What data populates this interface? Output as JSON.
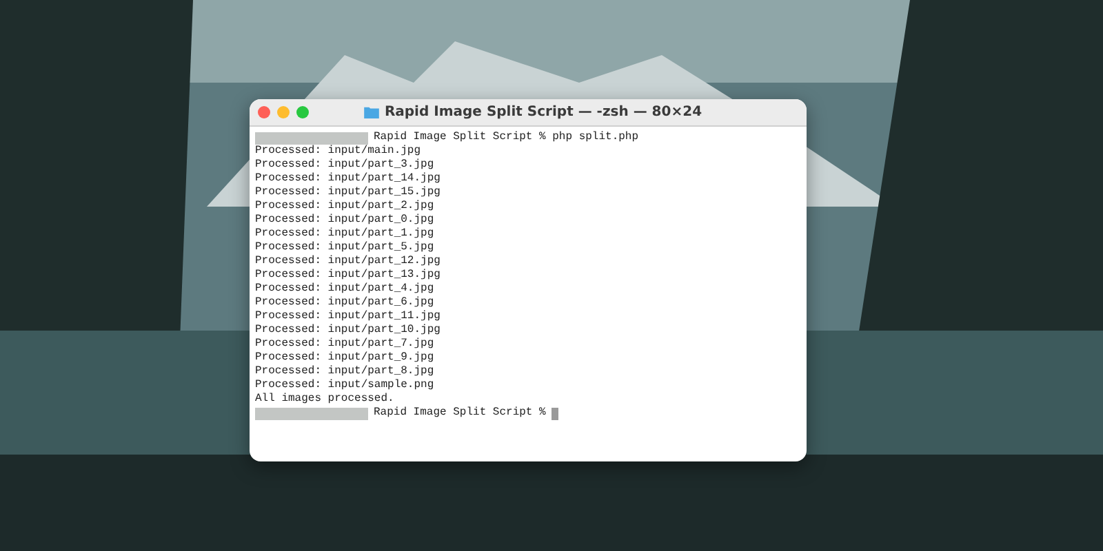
{
  "window": {
    "title": "Rapid Image Split Script — -zsh — 80×24"
  },
  "terminal": {
    "lines": [
      {
        "kind": "prompt",
        "text": "Rapid Image Split Script % php split.php",
        "cursor": false
      },
      {
        "kind": "output",
        "text": "Processed: input/main.jpg"
      },
      {
        "kind": "output",
        "text": "Processed: input/part_3.jpg"
      },
      {
        "kind": "output",
        "text": "Processed: input/part_14.jpg"
      },
      {
        "kind": "output",
        "text": "Processed: input/part_15.jpg"
      },
      {
        "kind": "output",
        "text": "Processed: input/part_2.jpg"
      },
      {
        "kind": "output",
        "text": "Processed: input/part_0.jpg"
      },
      {
        "kind": "output",
        "text": "Processed: input/part_1.jpg"
      },
      {
        "kind": "output",
        "text": "Processed: input/part_5.jpg"
      },
      {
        "kind": "output",
        "text": "Processed: input/part_12.jpg"
      },
      {
        "kind": "output",
        "text": "Processed: input/part_13.jpg"
      },
      {
        "kind": "output",
        "text": "Processed: input/part_4.jpg"
      },
      {
        "kind": "output",
        "text": "Processed: input/part_6.jpg"
      },
      {
        "kind": "output",
        "text": "Processed: input/part_11.jpg"
      },
      {
        "kind": "output",
        "text": "Processed: input/part_10.jpg"
      },
      {
        "kind": "output",
        "text": "Processed: input/part_7.jpg"
      },
      {
        "kind": "output",
        "text": "Processed: input/part_9.jpg"
      },
      {
        "kind": "output",
        "text": "Processed: input/part_8.jpg"
      },
      {
        "kind": "output",
        "text": "Processed: input/sample.png"
      },
      {
        "kind": "output",
        "text": "All images processed."
      },
      {
        "kind": "prompt",
        "text": "Rapid Image Split Script %",
        "cursor": true
      }
    ]
  }
}
